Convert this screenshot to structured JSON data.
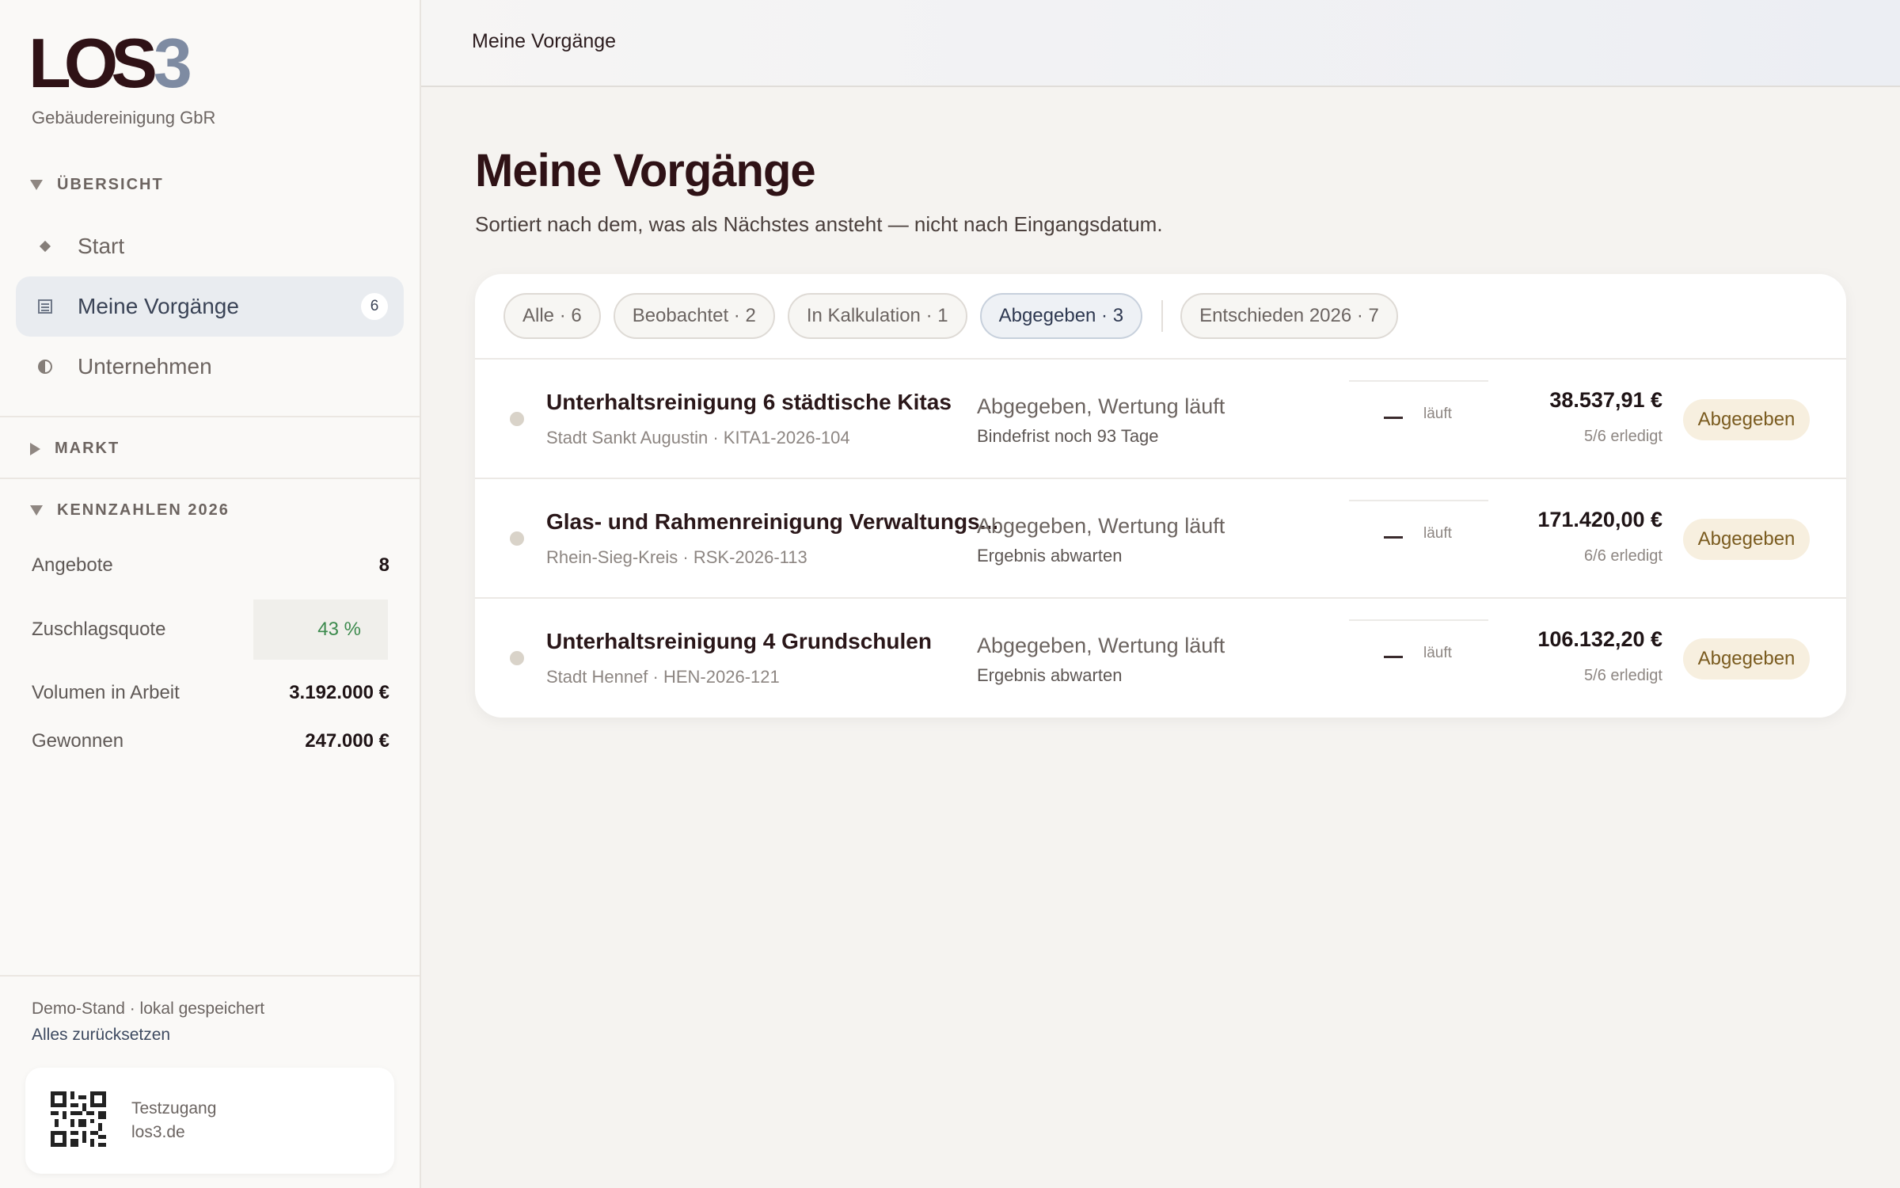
{
  "brand": {
    "logo_a": "LOS",
    "logo_b": "3",
    "company": "Gebäudereinigung GbR"
  },
  "sidebar": {
    "overview_header": "ÜBERSICHT",
    "nav": [
      {
        "label": "Start",
        "icon": "diamond-icon"
      },
      {
        "label": "Meine Vorgänge",
        "icon": "list-icon",
        "badge": "6",
        "active": true
      },
      {
        "label": "Unternehmen",
        "icon": "half-circle-icon"
      }
    ],
    "market_header": "MARKT",
    "kpi_header": "KENNZAHLEN 2026",
    "kpis": [
      {
        "label": "Angebote",
        "value": "8"
      },
      {
        "label": "Zuschlagsquote",
        "value": "43 %"
      },
      {
        "label": "Volumen in Arbeit",
        "value": "3.192.000 €"
      },
      {
        "label": "Gewonnen",
        "value": "247.000 €"
      }
    ],
    "demo_text": "Demo-Stand · lokal gespeichert",
    "reset_label": "Alles zurücksetzen",
    "test_access": {
      "line1": "Testzugang",
      "line2": "los3.de"
    }
  },
  "topbar": {
    "breadcrumb": "Meine Vorgänge"
  },
  "main": {
    "title": "Meine Vorgänge",
    "subtitle": "Sortiert nach dem, was als Nächstes ansteht — nicht nach Eingangsdatum.",
    "filters": [
      {
        "label": "Alle · 6"
      },
      {
        "label": "Beobachtet · 2"
      },
      {
        "label": "In Kalkulation · 1"
      },
      {
        "label": "Abgegeben · 3",
        "active": true
      },
      {
        "label": "Entschieden 2026 · 7"
      }
    ],
    "rows": [
      {
        "title": "Unterhaltsreinigung 6 städtische Kitas",
        "meta": "Stadt Sankt Augustin · KITA1-2026-104",
        "status": "Abgegeben, Wertung läuft",
        "status_sub": "Bindefrist noch 93 Tage",
        "progress_label": "läuft",
        "amount": "38.537,91 €",
        "done": "5/6 erledigt",
        "pill": "Abgegeben"
      },
      {
        "title": "Glas- und Rahmenreinigung Verwaltungs...",
        "meta": "Rhein-Sieg-Kreis · RSK-2026-113",
        "status": "Abgegeben, Wertung läuft",
        "status_sub": "Ergebnis abwarten",
        "progress_label": "läuft",
        "amount": "171.420,00 €",
        "done": "6/6 erledigt",
        "pill": "Abgegeben"
      },
      {
        "title": "Unterhaltsreinigung 4 Grundschulen",
        "meta": "Stadt Hennef · HEN-2026-121",
        "status": "Abgegeben, Wertung läuft",
        "status_sub": "Ergebnis abwarten",
        "progress_label": "läuft",
        "amount": "106.132,20 €",
        "done": "5/6 erledigt",
        "pill": "Abgegeben"
      }
    ]
  },
  "colors": {
    "brand_dark": "#2f1216",
    "brand_accent": "#7e8ba2",
    "positive": "#3c8a4d",
    "pill_bg": "#f7efdf"
  }
}
